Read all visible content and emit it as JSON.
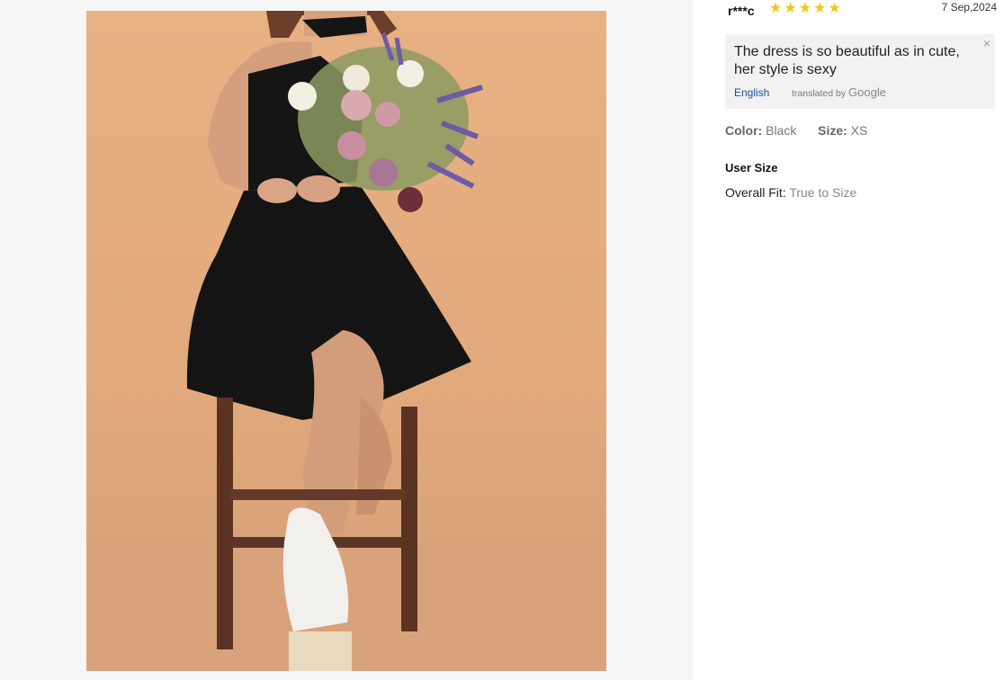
{
  "review": {
    "reviewer": "r***c",
    "rating": 5,
    "stars": [
      "★",
      "★",
      "★",
      "★",
      "★"
    ],
    "date": "7 Sep,2024",
    "text": "The dress is so beautiful as in cute, her style is sexy",
    "language_link": "English",
    "translated_by_prefix": "translated by",
    "translated_by_brand": "Google",
    "close_glyph": "×"
  },
  "attributes": {
    "color_label": "Color:",
    "color_value": "Black",
    "size_label": "Size:",
    "size_value": "XS"
  },
  "user_size": {
    "title": "User Size",
    "overall_fit_label": "Overall Fit:",
    "overall_fit_value": "True to Size"
  },
  "colors": {
    "star": "#f5c518",
    "link": "#1a4fa0",
    "backdrop": "#e2aa7c",
    "dress": "#141414"
  },
  "icons": {
    "star": "star-icon",
    "close": "close-icon"
  }
}
